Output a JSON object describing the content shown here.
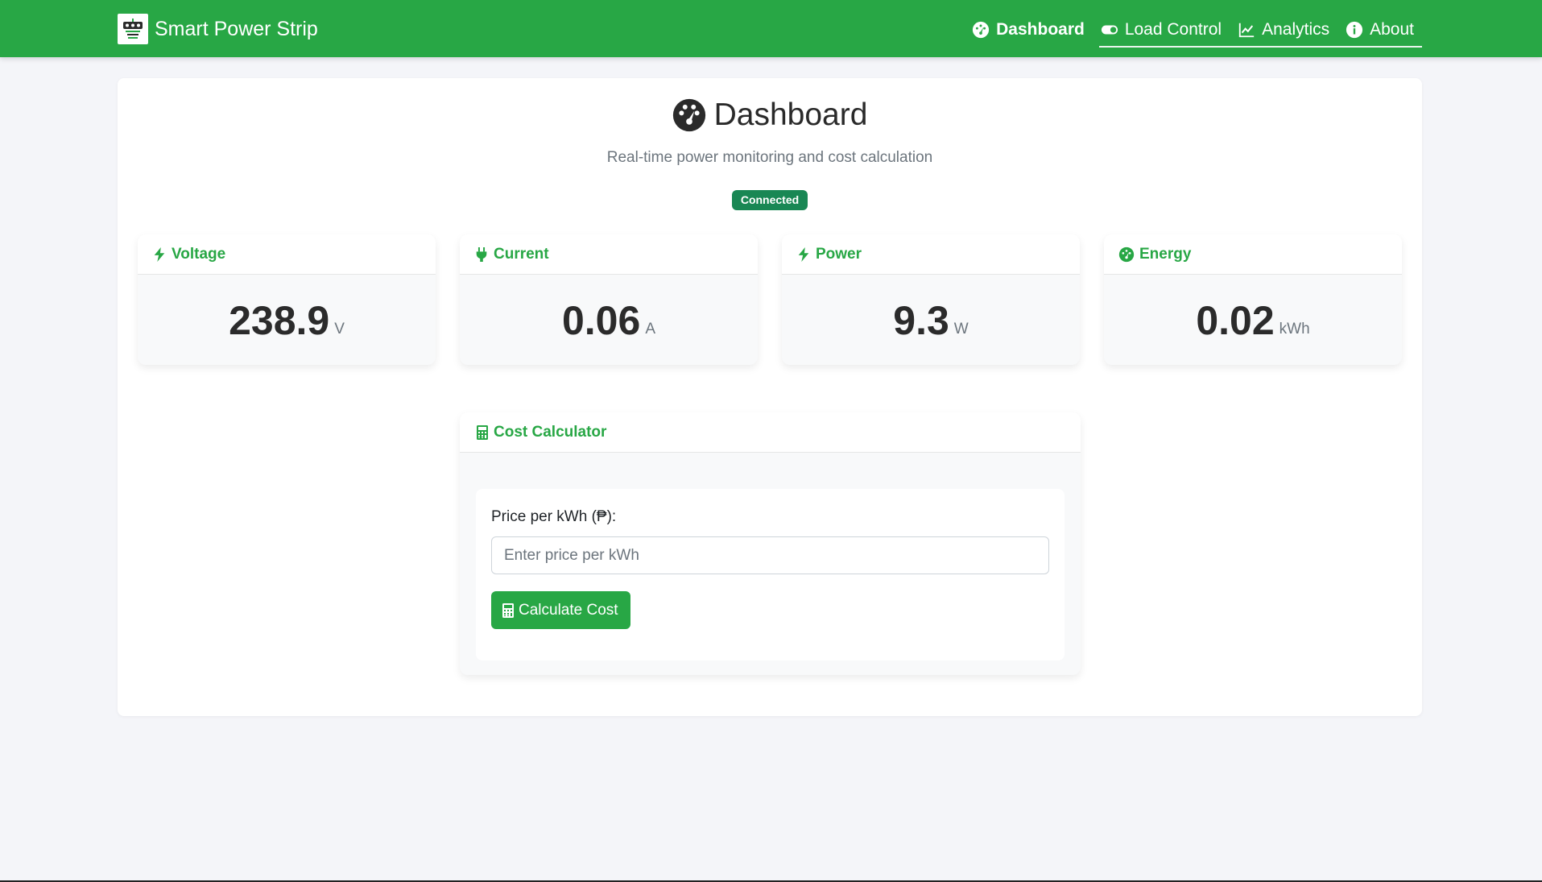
{
  "navbar": {
    "brand": "Smart Power Strip",
    "items": [
      {
        "label": "Dashboard",
        "icon": "gauge-icon",
        "active": true
      },
      {
        "label": "Load Control",
        "icon": "toggle-icon",
        "active": false
      },
      {
        "label": "Analytics",
        "icon": "chart-line-icon",
        "active": false
      },
      {
        "label": "About",
        "icon": "info-circle-icon",
        "active": false
      }
    ],
    "color": "#28a745"
  },
  "main": {
    "title": "Dashboard",
    "subtitle": "Real-time power monitoring and cost calculation",
    "status": "Connected",
    "status_color": "#198754"
  },
  "metrics": [
    {
      "label": "Voltage",
      "value": "238.9",
      "unit": "V",
      "icon": "bolt-icon"
    },
    {
      "label": "Current",
      "value": "0.06",
      "unit": "A",
      "icon": "plug-icon"
    },
    {
      "label": "Power",
      "value": "9.3",
      "unit": "W",
      "icon": "bolt-icon"
    },
    {
      "label": "Energy",
      "value": "0.02",
      "unit": "kWh",
      "icon": "gauge-icon"
    }
  ],
  "calculator": {
    "title": "Cost Calculator",
    "price_label": "Price per kWh (₱):",
    "price_value": "",
    "price_placeholder": "Enter price per kWh",
    "button_label": "Calculate Cost"
  }
}
